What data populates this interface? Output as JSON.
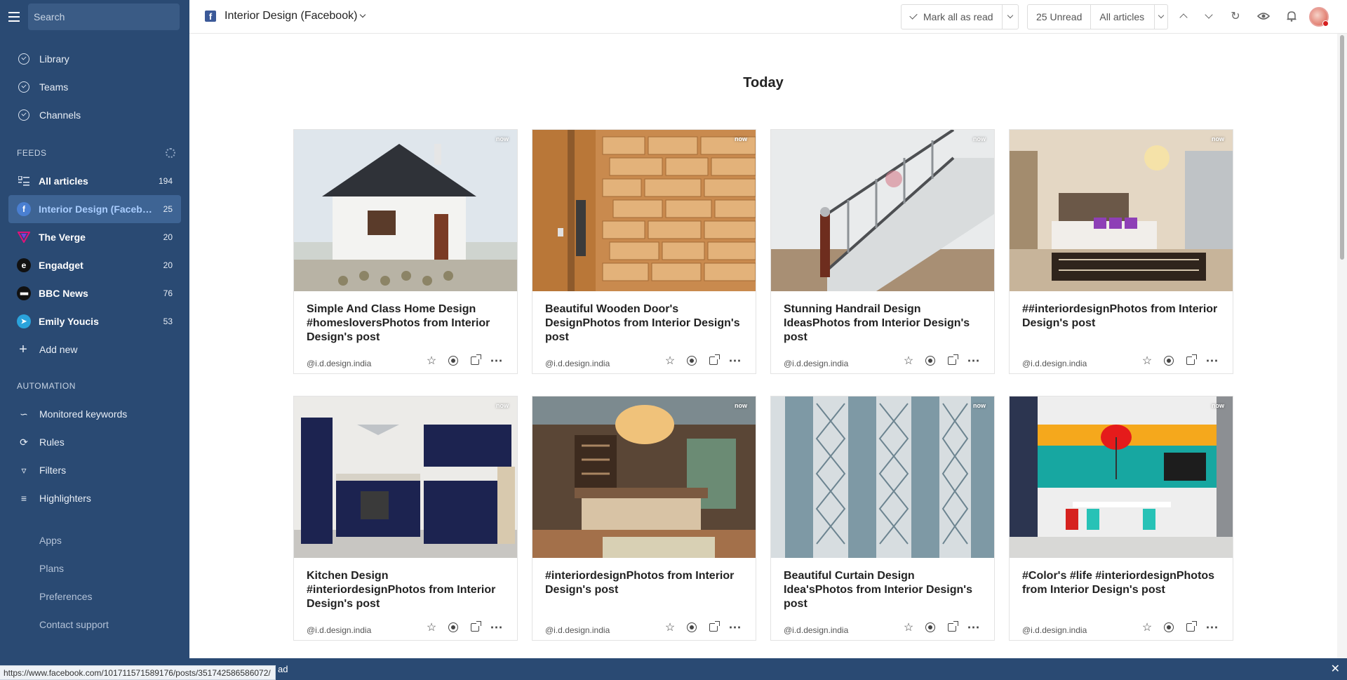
{
  "sidebar": {
    "search_placeholder": "Search",
    "nav": [
      {
        "label": "Library"
      },
      {
        "label": "Teams"
      },
      {
        "label": "Channels"
      }
    ],
    "feeds_label": "FEEDS",
    "feeds": [
      {
        "label": "All articles",
        "count": "194",
        "icon": "list-icon",
        "color": "#2a4a73"
      },
      {
        "label": "Interior Design (Facebook)",
        "count": "25",
        "icon": "facebook-icon",
        "color": "#3b5998"
      },
      {
        "label": "The Verge",
        "count": "20",
        "icon": "verge-icon",
        "color": "#e2127a"
      },
      {
        "label": "Engadget",
        "count": "20",
        "icon": "engadget-icon",
        "color": "#111111"
      },
      {
        "label": "BBC News",
        "count": "76",
        "icon": "bbc-icon",
        "color": "#111111"
      },
      {
        "label": "Emily Youcis",
        "count": "53",
        "icon": "telegram-icon",
        "color": "#2aa3dc"
      }
    ],
    "add_new": "Add new",
    "automation_label": "AUTOMATION",
    "automation": [
      {
        "label": "Monitored keywords",
        "icon": "pulse-icon"
      },
      {
        "label": "Rules",
        "icon": "rules-icon"
      },
      {
        "label": "Filters",
        "icon": "filter-icon"
      },
      {
        "label": "Highlighters",
        "icon": "highlighter-icon"
      }
    ],
    "footer": [
      {
        "label": "Apps"
      },
      {
        "label": "Plans"
      },
      {
        "label": "Preferences"
      },
      {
        "label": "Contact support"
      }
    ]
  },
  "header": {
    "feed_title": "Interior Design (Facebook)",
    "mark_all_read": "Mark all as read",
    "unread": "25 Unread",
    "view_filter": "All articles"
  },
  "main": {
    "day_heading": "Today",
    "cards": [
      {
        "title": "Simple And Class Home Design #homesloversPhotos from Interior Design's post",
        "source": "@i.d.design.india",
        "time": "now"
      },
      {
        "title": "Beautiful Wooden Door's DesignPhotos from Interior Design's post",
        "source": "@i.d.design.india",
        "time": "now"
      },
      {
        "title": "Stunning Handrail Design IdeasPhotos from Interior Design's post",
        "source": "@i.d.design.india",
        "time": "now"
      },
      {
        "title": "##interiordesignPhotos from Interior Design's post",
        "source": "@i.d.design.india",
        "time": "now"
      },
      {
        "title": "Kitchen Design #interiordesignPhotos from Interior Design's post",
        "source": "@i.d.design.india",
        "time": "now"
      },
      {
        "title": "#interiordesignPhotos from Interior Design's post",
        "source": "@i.d.design.india",
        "time": "now"
      },
      {
        "title": "Beautiful Curtain Design Idea'sPhotos from Interior Design's post",
        "source": "@i.d.design.india",
        "time": "now"
      },
      {
        "title": "#Color's #life #interiordesignPhotos from Interior Design's post",
        "source": "@i.d.design.india",
        "time": "now"
      }
    ]
  },
  "bottom_bar": {
    "text": "ad"
  },
  "status_url": "https://www.facebook.com/101711571589176/posts/351742586586072/"
}
